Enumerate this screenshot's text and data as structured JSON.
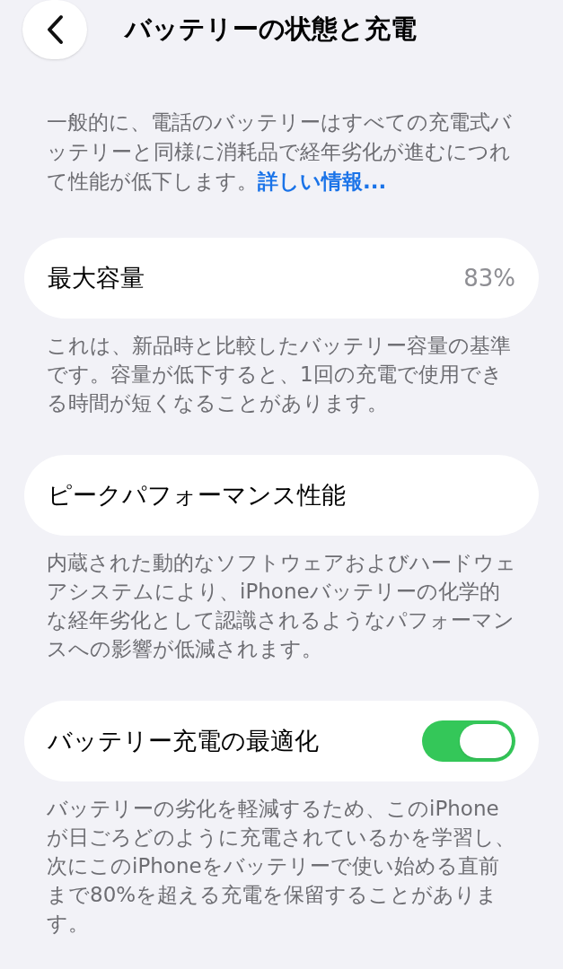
{
  "header": {
    "title": "バッテリーの状態と充電"
  },
  "intro": {
    "text": "一般的に、電話のバッテリーはすべての充電式バッテリーと同様に消耗品で経年劣化が進むにつれて性能が低下します。",
    "link": "詳しい情報..."
  },
  "sections": [
    {
      "kind": "value",
      "label": "最大容量",
      "value": "83%",
      "footnote": "これは、新品時と比較したバッテリー容量の基準です。容量が低下すると、1回の充電で使用できる時間が短くなることがあります。"
    },
    {
      "kind": "plain",
      "label": "ピークパフォーマンス性能",
      "footnote": "内蔵された動的なソフトウェアおよびハードウェアシステムにより、iPhoneバッテリーの化学的な経年劣化として認識されるようなパフォーマンスへの影響が低減されます。"
    },
    {
      "kind": "toggle",
      "label": "バッテリー充電の最適化",
      "on": true,
      "footnote": "バッテリーの劣化を軽減するため、このiPhoneが日ごろどのように充電されているかを学習し、次にこのiPhoneをバッテリーで使い始める直前まで80%を超える充電を保留することがあります。"
    }
  ]
}
